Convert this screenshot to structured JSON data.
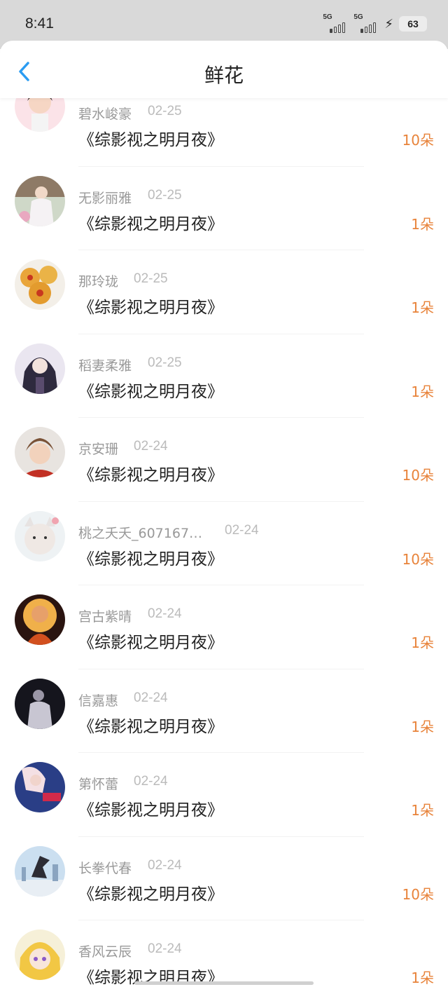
{
  "status_bar": {
    "time": "8:41",
    "sim1_label": "5G",
    "sim2_label": "5G",
    "battery": "63"
  },
  "header": {
    "title": "鲜花",
    "back_icon": "chevron-left-icon",
    "accent": "#2b9cf2"
  },
  "colors": {
    "count": "#e8833a",
    "name": "#999999",
    "date": "#bbbbbb",
    "book": "#222222"
  },
  "entries": [
    {
      "name": "碧水峻豪",
      "date": "02-25",
      "book": "《综影视之明月夜》",
      "count": "10朵"
    },
    {
      "name": "无影丽雅",
      "date": "02-25",
      "book": "《综影视之明月夜》",
      "count": "1朵"
    },
    {
      "name": "那玲珑",
      "date": "02-25",
      "book": "《综影视之明月夜》",
      "count": "1朵"
    },
    {
      "name": "稻妻柔雅",
      "date": "02-25",
      "book": "《综影视之明月夜》",
      "count": "1朵"
    },
    {
      "name": "京安珊",
      "date": "02-24",
      "book": "《综影视之明月夜》",
      "count": "10朵"
    },
    {
      "name": "桃之夭夭_607167…",
      "date": "02-24",
      "book": "《综影视之明月夜》",
      "count": "10朵"
    },
    {
      "name": "宫古紫晴",
      "date": "02-24",
      "book": "《综影视之明月夜》",
      "count": "1朵"
    },
    {
      "name": "信嘉惠",
      "date": "02-24",
      "book": "《综影视之明月夜》",
      "count": "1朵"
    },
    {
      "name": "第怀蕾",
      "date": "02-24",
      "book": "《综影视之明月夜》",
      "count": "1朵"
    },
    {
      "name": "长拳代春",
      "date": "02-24",
      "book": "《综影视之明月夜》",
      "count": "10朵"
    },
    {
      "name": "香风云辰",
      "date": "02-24",
      "book": "《综影视之明月夜》",
      "count": "1朵"
    }
  ]
}
